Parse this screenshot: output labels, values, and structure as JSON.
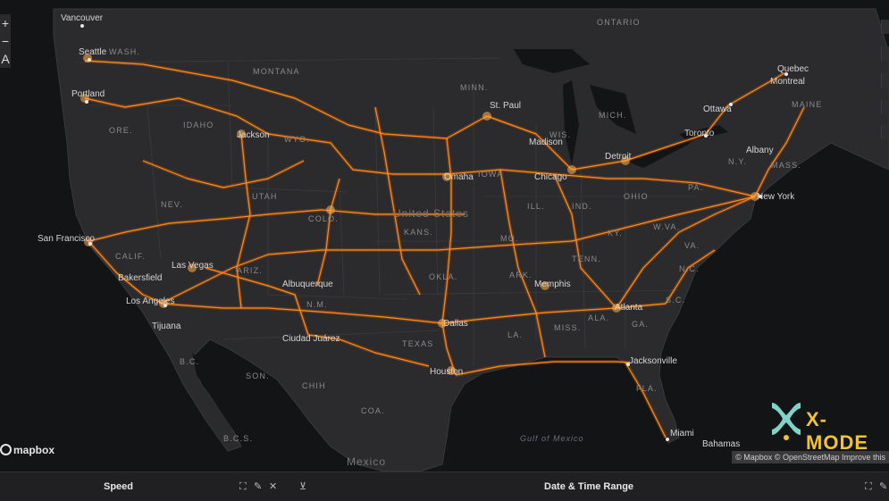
{
  "map": {
    "countries": [
      "United States",
      "Mexico"
    ],
    "states": [
      "WASH.",
      "MONTANA",
      "IDAHO",
      "ORE.",
      "WYO.",
      "NEV.",
      "UTAH",
      "COLO.",
      "CALIF.",
      "ARIZ.",
      "N.M.",
      "KANS.",
      "OKLA.",
      "TEXAS",
      "ARK.",
      "LA.",
      "MISS.",
      "ALA.",
      "GA.",
      "TENN.",
      "KY.",
      "ILL.",
      "IND.",
      "OHIO",
      "MICH.",
      "WIS.",
      "MINN.",
      "IOWA",
      "MO.",
      "W.VA.",
      "VA.",
      "N.C.",
      "S.C.",
      "FLA.",
      "PA.",
      "N.Y.",
      "MASS.",
      "MAINE",
      "ONTARIO",
      "B.C.S.",
      "CHIH",
      "SON.",
      "COA.",
      "B.C."
    ],
    "cities": [
      "Vancouver",
      "Seattle",
      "Portland",
      "Jackson",
      "San Francisco",
      "Bakersfield",
      "Las Vegas",
      "Los Angeles",
      "Tijuana",
      "Albuquerque",
      "Ciudad Juárez",
      "Dallas",
      "Houston",
      "Memphis",
      "Atlanta",
      "Jacksonville",
      "Miami",
      "Bahamas",
      "Chicago",
      "Detroit",
      "Toronto",
      "Ottawa",
      "Montreal",
      "Quebec",
      "Albany",
      "New York",
      "Madison",
      "St. Paul",
      "Omaha"
    ],
    "water": [
      "Gulf of Mexico"
    ],
    "attribution": "© Mapbox © OpenStreetMap  Improve this",
    "mapbox_logo": "mapbox",
    "brand_logo_text": "X-MODE"
  },
  "zoom": {
    "in": "+",
    "out": "−",
    "reset": "A"
  },
  "panels": {
    "speed_title": "Speed",
    "date_title": "Date & Time Range"
  }
}
